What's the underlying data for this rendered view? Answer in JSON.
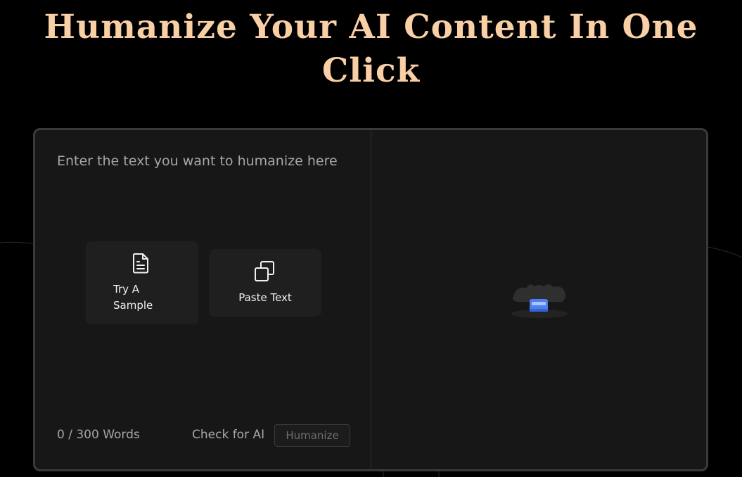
{
  "hero": {
    "title_line1": "Humanize Your AI Content In One",
    "title_line2": "Click"
  },
  "editor": {
    "placeholder": "Enter the text you want to humanize here",
    "actions": [
      {
        "label": "Try A Sample",
        "icon": "document-icon"
      },
      {
        "label": "Paste Text",
        "icon": "copy-icon"
      }
    ],
    "word_count": "0 / 300 Words",
    "check_ai_label": "Check for AI",
    "humanize_label": "Humanize"
  },
  "output": {
    "illustration": "empty-inbox-illustration"
  },
  "colors": {
    "background": "#000000",
    "heading": "#f9cfa6",
    "panel": "#171717",
    "panel_border": "#3a3a3a",
    "card": "#1f1f1f",
    "muted_text": "#a4a7ab",
    "accent_blue": "#5b8cf5"
  }
}
